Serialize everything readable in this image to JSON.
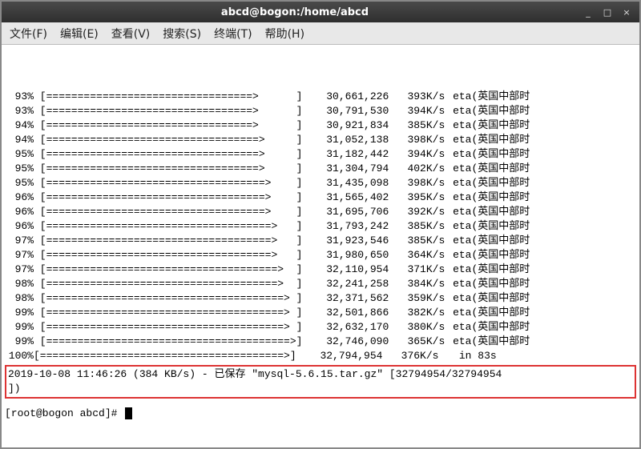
{
  "window": {
    "title": "abcd@bogon:/home/abcd",
    "min": "_",
    "max": "□",
    "close": "×"
  },
  "menu": {
    "file": "文件(F)",
    "edit": "编辑(E)",
    "view": "查看(V)",
    "search": "搜索(S)",
    "terminal": "终端(T)",
    "help": "帮助(H)"
  },
  "progress_rows": [
    {
      "pct": "93%",
      "bar": " [=================================>      ] ",
      "bytes": "30,661,226",
      "speed": "393K/s",
      "eta": " eta(英国中部时"
    },
    {
      "pct": "93%",
      "bar": " [=================================>      ] ",
      "bytes": "30,791,530",
      "speed": "394K/s",
      "eta": " eta(英国中部时"
    },
    {
      "pct": "94%",
      "bar": " [=================================>      ] ",
      "bytes": "30,921,834",
      "speed": "385K/s",
      "eta": " eta(英国中部时"
    },
    {
      "pct": "94%",
      "bar": " [==================================>     ] ",
      "bytes": "31,052,138",
      "speed": "398K/s",
      "eta": " eta(英国中部时"
    },
    {
      "pct": "95%",
      "bar": " [==================================>     ] ",
      "bytes": "31,182,442",
      "speed": "394K/s",
      "eta": " eta(英国中部时"
    },
    {
      "pct": "95%",
      "bar": " [==================================>     ] ",
      "bytes": "31,304,794",
      "speed": "402K/s",
      "eta": " eta(英国中部时"
    },
    {
      "pct": "95%",
      "bar": " [===================================>    ] ",
      "bytes": "31,435,098",
      "speed": "398K/s",
      "eta": " eta(英国中部时"
    },
    {
      "pct": "96%",
      "bar": " [===================================>    ] ",
      "bytes": "31,565,402",
      "speed": "395K/s",
      "eta": " eta(英国中部时"
    },
    {
      "pct": "96%",
      "bar": " [===================================>    ] ",
      "bytes": "31,695,706",
      "speed": "392K/s",
      "eta": " eta(英国中部时"
    },
    {
      "pct": "96%",
      "bar": " [====================================>   ] ",
      "bytes": "31,793,242",
      "speed": "385K/s",
      "eta": " eta(英国中部时"
    },
    {
      "pct": "97%",
      "bar": " [====================================>   ] ",
      "bytes": "31,923,546",
      "speed": "385K/s",
      "eta": " eta(英国中部时"
    },
    {
      "pct": "97%",
      "bar": " [====================================>   ] ",
      "bytes": "31,980,650",
      "speed": "364K/s",
      "eta": " eta(英国中部时"
    },
    {
      "pct": "97%",
      "bar": " [=====================================>  ] ",
      "bytes": "32,110,954",
      "speed": "371K/s",
      "eta": " eta(英国中部时"
    },
    {
      "pct": "98%",
      "bar": " [=====================================>  ] ",
      "bytes": "32,241,258",
      "speed": "384K/s",
      "eta": " eta(英国中部时"
    },
    {
      "pct": "98%",
      "bar": " [======================================> ] ",
      "bytes": "32,371,562",
      "speed": "359K/s",
      "eta": " eta(英国中部时"
    },
    {
      "pct": "99%",
      "bar": " [======================================> ] ",
      "bytes": "32,501,866",
      "speed": "382K/s",
      "eta": " eta(英国中部时"
    },
    {
      "pct": "99%",
      "bar": " [======================================> ] ",
      "bytes": "32,632,170",
      "speed": "380K/s",
      "eta": " eta(英国中部时"
    },
    {
      "pct": "99%",
      "bar": " [=======================================>] ",
      "bytes": "32,746,090",
      "speed": "365K/s",
      "eta": " eta(英国中部时"
    },
    {
      "pct": "100%",
      "bar": "[=======================================>] ",
      "bytes": "32,794,954",
      "speed": "376K/s",
      "eta": "   in 83s"
    }
  ],
  "saved": {
    "line1": "2019-10-08 11:46:26 (384 KB/s) - 已保存 \"mysql-5.6.15.tar.gz\" [32794954/32794954",
    "line2": "])"
  },
  "prompt": "[root@bogon abcd]# "
}
